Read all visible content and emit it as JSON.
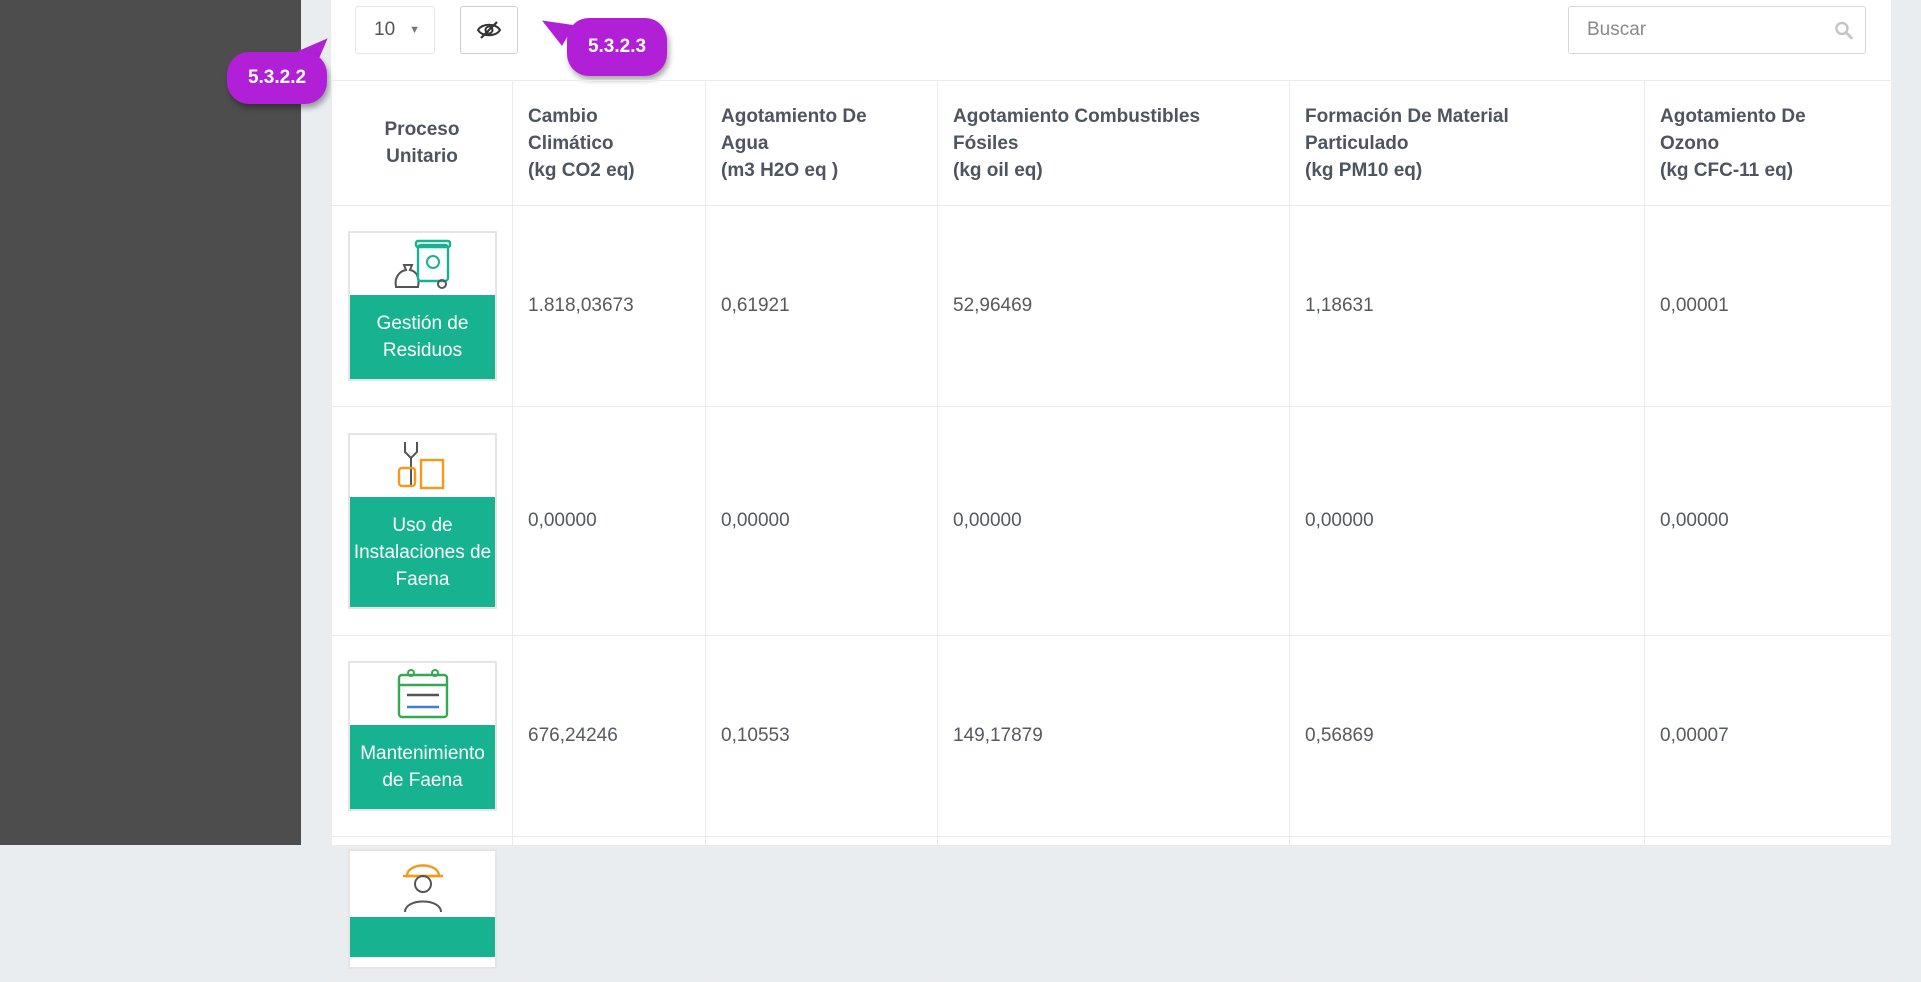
{
  "toolbar": {
    "page_size": "10",
    "search_placeholder": "Buscar",
    "callouts": [
      "5.3.2.2",
      "5.3.2.3"
    ]
  },
  "table": {
    "headers": [
      {
        "title": "Proceso Unitario",
        "lines": [
          "Proceso",
          "Unitario"
        ]
      },
      {
        "lines": [
          "Cambio",
          "Climático",
          "(kg CO2 eq)"
        ]
      },
      {
        "lines": [
          "Agotamiento De",
          "Agua",
          "(m3 H2O eq )"
        ]
      },
      {
        "lines": [
          "Agotamiento Combustibles",
          "Fósiles",
          "(kg oil eq)"
        ]
      },
      {
        "lines": [
          "Formación De Material",
          "Particulado",
          "(kg PM10 eq)"
        ]
      },
      {
        "lines": [
          "Agotamiento De",
          "Ozono",
          "(kg CFC-11 eq)"
        ]
      }
    ],
    "rows": [
      {
        "process": [
          "Gestión de",
          "Residuos"
        ],
        "icon": "waste-bin-icon",
        "values": [
          "1.818,03673",
          "0,61921",
          "52,96469",
          "1,18631",
          "0,00001"
        ]
      },
      {
        "process": [
          "Uso de",
          "Instalaciones de",
          "Faena"
        ],
        "icon": "tools-hand-icon",
        "values": [
          "0,00000",
          "0,00000",
          "0,00000",
          "0,00000",
          "0,00000"
        ]
      },
      {
        "process": [
          "Mantenimiento",
          "de Faena"
        ],
        "icon": "maintenance-calendar-icon",
        "values": [
          "676,24246",
          "0,10553",
          "149,17879",
          "0,56869",
          "0,00007"
        ]
      },
      {
        "process": [],
        "icon": "worker-helmet-icon",
        "values": [
          "",
          "",
          "",
          "",
          ""
        ]
      }
    ]
  },
  "colors": {
    "accent": "#17b391",
    "callout": "#b11fd6",
    "sidebar": "#4d4d4d"
  }
}
